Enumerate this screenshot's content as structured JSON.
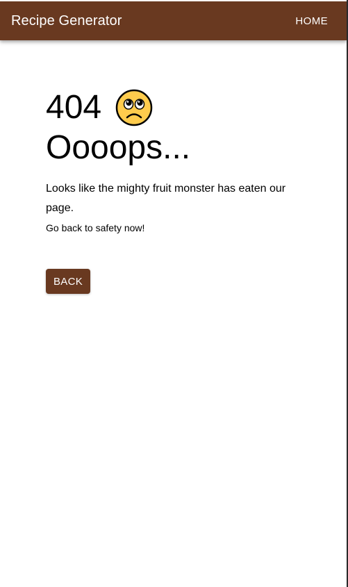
{
  "app": {
    "title": "Recipe Generator",
    "brand_color": "#693920"
  },
  "nav": {
    "home_label": "HOME"
  },
  "error": {
    "code": "404",
    "emoji_icon": "worried-face-icon",
    "headline": "Oooops...",
    "message": "Looks like the mighty fruit monster has eaten our page.",
    "subtext": "Go back to safety now!"
  },
  "actions": {
    "back_label": "BACK"
  }
}
